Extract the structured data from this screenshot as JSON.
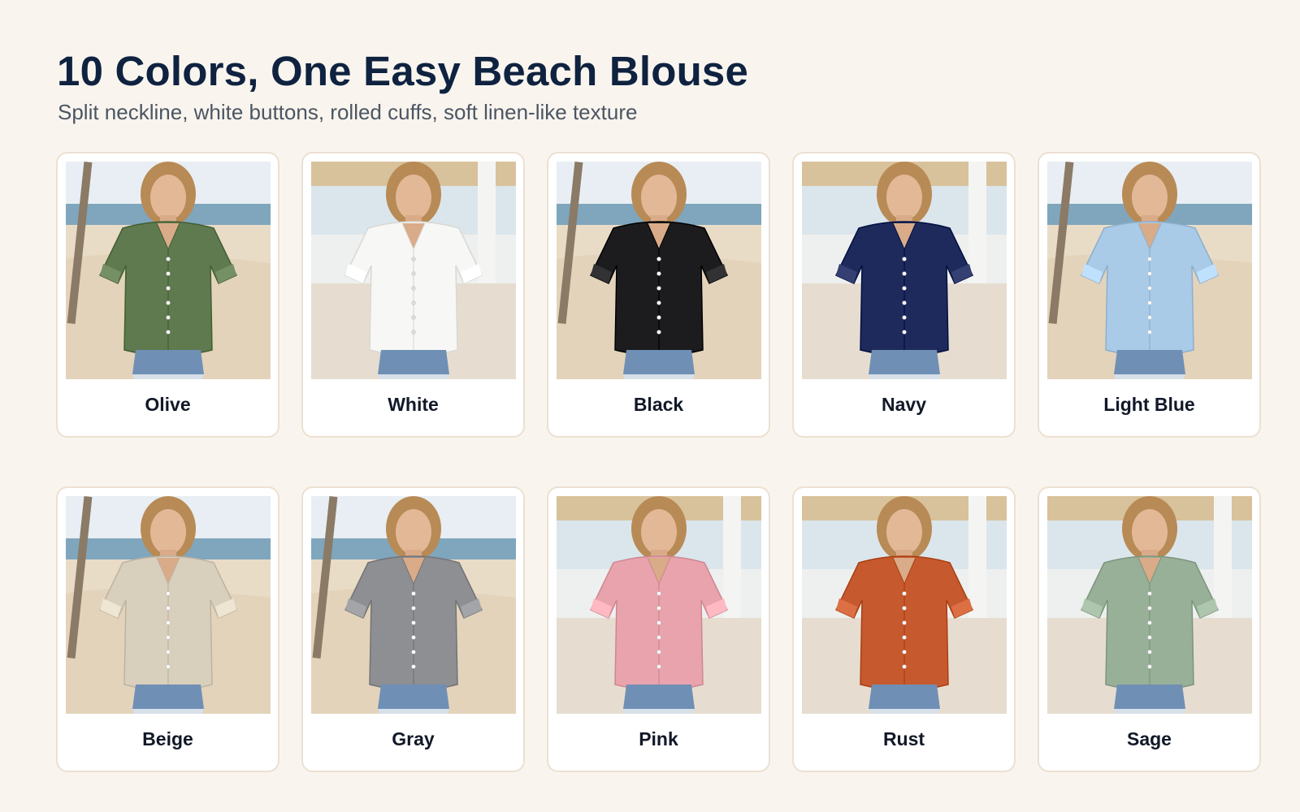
{
  "header": {
    "title": "10 Colors, One Easy Beach Blouse",
    "subtitle": "Split neckline, white buttons, rolled cuffs, soft linen-like texture"
  },
  "swatches": [
    {
      "label": "Olive",
      "color": "#5f7a4f",
      "scene": "beach"
    },
    {
      "label": "White",
      "color": "#f7f7f5",
      "scene": "cabana"
    },
    {
      "label": "Black",
      "color": "#1c1c1e",
      "scene": "beach"
    },
    {
      "label": "Navy",
      "color": "#1f2a5c",
      "scene": "cabana"
    },
    {
      "label": "Light Blue",
      "color": "#a9cbe8",
      "scene": "beach"
    },
    {
      "label": "Beige",
      "color": "#d9cfbd",
      "scene": "beach"
    },
    {
      "label": "Gray",
      "color": "#8e8f92",
      "scene": "beach"
    },
    {
      "label": "Pink",
      "color": "#e9a3ad",
      "scene": "cabana"
    },
    {
      "label": "Rust",
      "color": "#c65a2e",
      "scene": "cabana"
    },
    {
      "label": "Sage",
      "color": "#98b098",
      "scene": "cabana"
    }
  ]
}
